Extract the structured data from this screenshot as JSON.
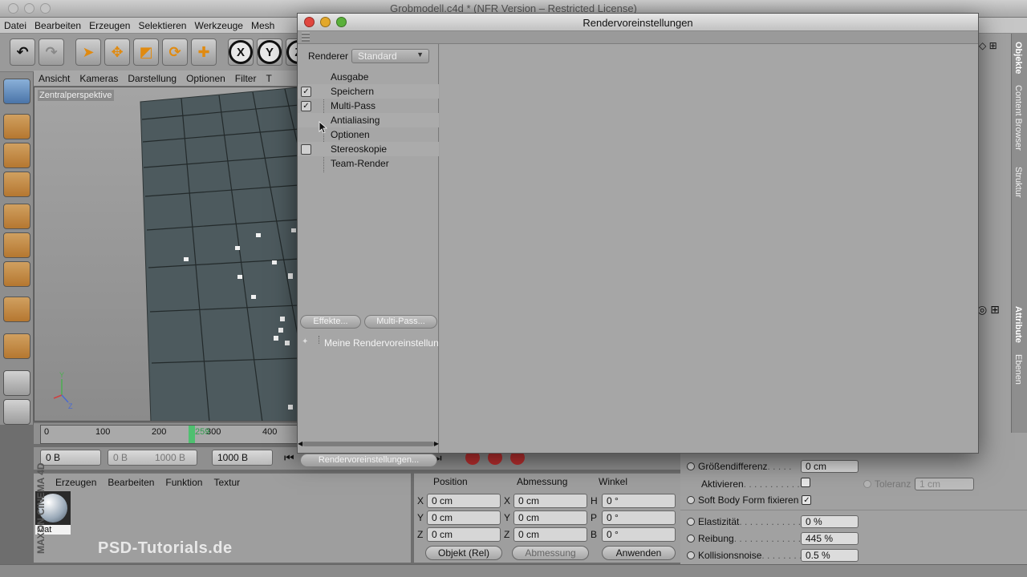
{
  "app": {
    "window_title": "Grobmodell.c4d * (NFR Version – Restricted License)",
    "menu": [
      "Datei",
      "Bearbeiten",
      "Erzeugen",
      "Selektieren",
      "Werkzeuge",
      "Mesh"
    ],
    "axis_buttons": [
      "X",
      "Y",
      "Z"
    ]
  },
  "viewport": {
    "menu": [
      "Ansicht",
      "Kameras",
      "Darstellung",
      "Optionen",
      "Filter",
      "T"
    ],
    "label": "Zentralperspektive"
  },
  "timeline": {
    "ticks": [
      "0",
      "100",
      "200",
      "300",
      "400"
    ],
    "current_frame": "259"
  },
  "transport": {
    "start": "0 B",
    "range_start": "0 B",
    "range_end": "1000 B",
    "end": "1000 B"
  },
  "material_manager": {
    "menu": [
      "Erzeugen",
      "Bearbeiten",
      "Funktion",
      "Textur"
    ],
    "material_name": "Mat"
  },
  "coordinates": {
    "headers": [
      "Position",
      "Abmessung",
      "Winkel"
    ],
    "rows": [
      {
        "pos_label": "X",
        "pos": "0 cm",
        "size_label": "X",
        "size": "0 cm",
        "rot_label": "H",
        "rot": "0 °"
      },
      {
        "pos_label": "Y",
        "pos": "0 cm",
        "size_label": "Y",
        "size": "0 cm",
        "rot_label": "P",
        "rot": "0 °"
      },
      {
        "pos_label": "Z",
        "pos": "0 cm",
        "size_label": "Z",
        "size": "0 cm",
        "rot_label": "B",
        "rot": "0 °"
      }
    ],
    "mode_select": "Objekt (Rel)",
    "size_select": "Abmessung",
    "apply_button": "Anwenden"
  },
  "attributes": {
    "groessendifferenz_label": "Größendifferenz",
    "groessendifferenz_value": "0 cm",
    "aktivieren_label": "Aktivieren",
    "toleranz_label": "Toleranz",
    "toleranz_value": "1 cm",
    "softbody_label": "Soft Body Form fixieren",
    "elastizitaet_label": "Elastizität",
    "elastizitaet_value": "0 %",
    "reibung_label": "Reibung",
    "reibung_value": "445 %",
    "kollision_label": "Kollisionsnoise",
    "kollision_value": "0.5 %"
  },
  "right_tabs": [
    "Objekte",
    "Content Browser",
    "Struktur",
    "Attribute",
    "Ebenen"
  ],
  "watermark": {
    "brand": "MAXON CINEMA 4D",
    "site": "PSD-Tutorials.de"
  },
  "dialog": {
    "title": "Rendervoreinstellungen",
    "renderer_label": "Renderer",
    "renderer_value": "Standard",
    "tree": [
      {
        "label": "Ausgabe",
        "checkbox": "none"
      },
      {
        "label": "Speichern",
        "checkbox": "checked"
      },
      {
        "label": "Multi-Pass",
        "checkbox": "checked"
      },
      {
        "label": "Antialiasing",
        "checkbox": "none"
      },
      {
        "label": "Optionen",
        "checkbox": "none"
      },
      {
        "label": "Stereoskopie",
        "checkbox": "unchecked"
      },
      {
        "label": "Team-Render",
        "checkbox": "none"
      }
    ],
    "effects_button": "Effekte...",
    "multipass_button": "Multi-Pass...",
    "preset_name": "Meine Rendervoreinstellun",
    "render_settings_button": "Rendervoreinstellungen..."
  }
}
